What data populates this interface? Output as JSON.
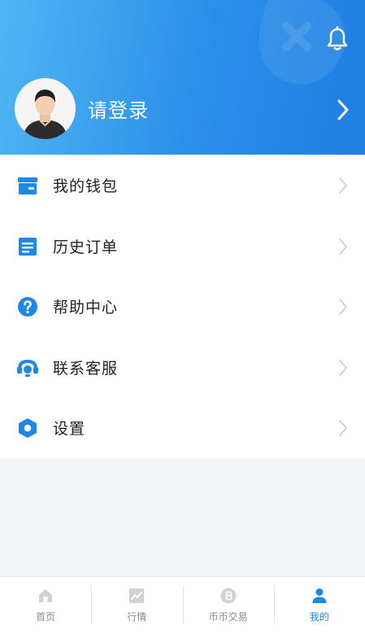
{
  "header": {
    "login_text": "请登录",
    "bell_icon": "bell-icon",
    "arrow_icon": "chevron-right-icon"
  },
  "menu": {
    "items": [
      {
        "label": "我的钱包",
        "icon": "wallet-icon"
      },
      {
        "label": "历史订单",
        "icon": "order-list-icon"
      },
      {
        "label": "帮助中心",
        "icon": "help-icon"
      },
      {
        "label": "联系客服",
        "icon": "customer-service-icon"
      },
      {
        "label": "设置",
        "icon": "settings-icon"
      }
    ]
  },
  "tabbar": {
    "tabs": [
      {
        "label": "首页",
        "icon": "home-icon",
        "active": false
      },
      {
        "label": "行情",
        "icon": "chart-icon",
        "active": false
      },
      {
        "label": "币币交易",
        "icon": "coin-icon",
        "active": false
      },
      {
        "label": "我的",
        "icon": "user-icon",
        "active": true
      }
    ]
  },
  "colors": {
    "accent": "#1e88e5",
    "header_start": "#4fb6f3",
    "header_end": "#1f7fe2",
    "inactive_tab": "#8a8a8a"
  }
}
